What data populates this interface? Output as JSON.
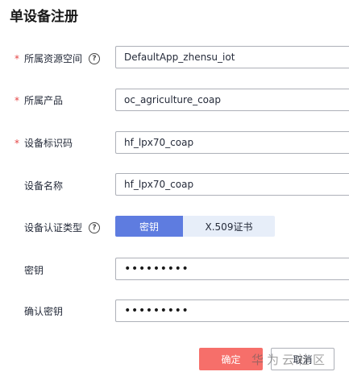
{
  "page": {
    "title": "单设备注册"
  },
  "form": {
    "resource_space": {
      "label": "所属资源空间",
      "value": "DefaultApp_zhensu_iot",
      "required": true
    },
    "product": {
      "label": "所属产品",
      "value": "oc_agriculture_coap",
      "required": true
    },
    "node_id": {
      "label": "设备标识码",
      "value": "hf_lpx70_coap",
      "required": true
    },
    "device_name": {
      "label": "设备名称",
      "value": "hf_lpx70_coap",
      "required": false
    },
    "auth_type": {
      "label": "设备认证类型",
      "options": [
        "密钥",
        "X.509证书"
      ],
      "selected": "密钥"
    },
    "secret": {
      "label": "密钥",
      "value": "•••••••••"
    },
    "confirm_secret": {
      "label": "确认密钥",
      "value": "•••••••••"
    },
    "required_mark": "*",
    "help_glyph": "?"
  },
  "actions": {
    "confirm": "确定",
    "cancel": "取消"
  },
  "watermark": {
    "text": "华为云社区"
  },
  "colors": {
    "primary": "#5e7ce0",
    "primary_light": "#e7eef9",
    "confirm": "#f66f6a",
    "required": "#e54545",
    "border": "#adb0b8"
  }
}
